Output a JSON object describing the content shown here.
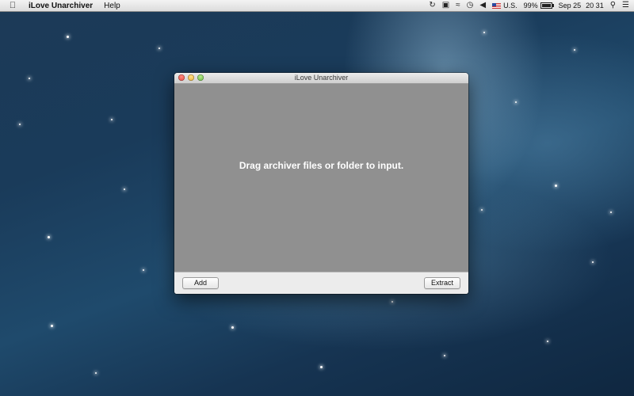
{
  "menubar": {
    "apple_icon": "apple-icon",
    "app_name": "iLove Unarchiver",
    "menus": [
      "Help"
    ],
    "status": {
      "input_source": "U.S.",
      "battery_percent": "99%",
      "battery_level": 0.99,
      "date": "Sep 25",
      "time": "20 31"
    }
  },
  "window": {
    "title": "iLove Unarchiver",
    "dropzone_text": "Drag archiver files or folder to input.",
    "add_label": "Add",
    "extract_label": "Extract"
  },
  "colors": {
    "dropzone_bg": "#909090",
    "window_bg": "#ececec"
  }
}
